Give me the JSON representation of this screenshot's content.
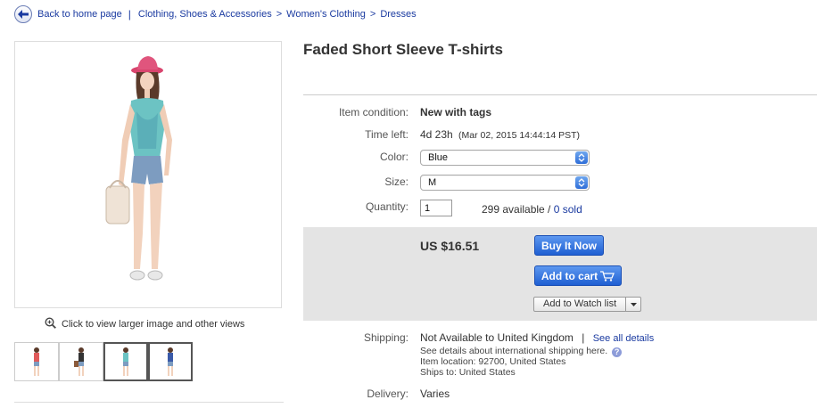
{
  "breadcrumb": {
    "back_label": "Back to home page",
    "separator": "|",
    "crumbs": [
      "Clothing, Shoes & Accessories",
      "Women's Clothing",
      "Dresses"
    ],
    "crumb_sep": ">"
  },
  "gallery": {
    "zoom_label": "Click to view larger image and other views",
    "thumb_count": 4,
    "selected_thumb": 3
  },
  "item": {
    "title": "Faded Short Sleeve T-shirts",
    "condition_label": "Item condition:",
    "condition_value": "New with tags",
    "time_label": "Time left:",
    "time_value": "4d 23h",
    "time_detail": "(Mar 02, 2015  14:44:14 PST)",
    "color_label": "Color:",
    "color_value": "Blue",
    "size_label": "Size:",
    "size_value": "M",
    "quantity_label": "Quantity:",
    "quantity_value": "1",
    "available": "299 available /",
    "sold": "0 sold"
  },
  "buy": {
    "price": "US $16.51",
    "buy_now": "Buy It Now",
    "add_to_cart": "Add to cart",
    "watch": "Add to Watch list"
  },
  "shipping": {
    "label": "Shipping:",
    "value": "Not Available to United Kingdom",
    "bar": "|",
    "see_all": "See all details",
    "intl": "See details about international shipping here.",
    "location": "Item location: 92700, United States",
    "ships_to": "Ships to: United States",
    "delivery_label": "Delivery:",
    "delivery_value": "Varies"
  },
  "colors": {
    "link": "#1a3aa0",
    "button": "#1f5fd2",
    "buy_box": "#e4e4e4"
  }
}
